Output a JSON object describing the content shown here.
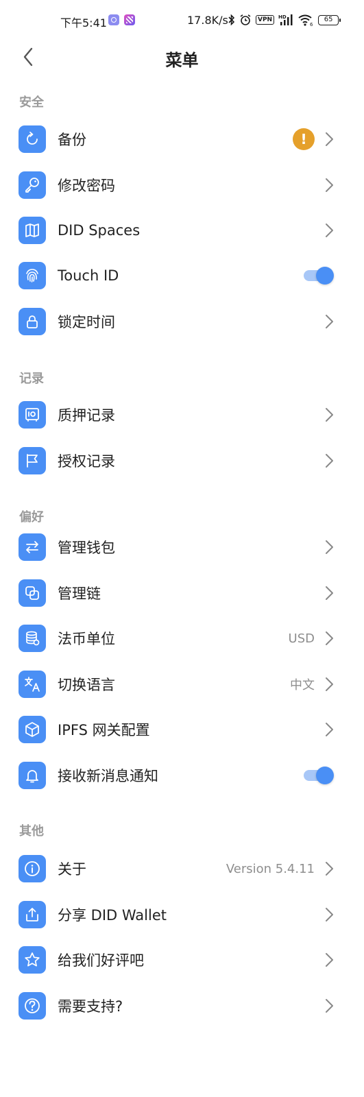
{
  "status_bar": {
    "time": "下午5:41",
    "speed": "17.8K/s",
    "vpn": "VPN",
    "hd": "HD",
    "wifi_sub": "6",
    "battery": "65"
  },
  "header": {
    "title": "菜单"
  },
  "sections": {
    "security": {
      "label": "安全",
      "backup": "备份",
      "backup_badge": "!",
      "change_password": "修改密码",
      "did_spaces": "DID Spaces",
      "touch_id": "Touch ID",
      "touch_id_enabled": true,
      "lock_time": "锁定时间"
    },
    "records": {
      "label": "记录",
      "stake_records": "质押记录",
      "auth_records": "授权记录"
    },
    "preferences": {
      "label": "偏好",
      "manage_wallet": "管理钱包",
      "manage_chain": "管理链",
      "fiat_unit": "法币单位",
      "fiat_unit_value": "USD",
      "switch_language": "切换语言",
      "switch_language_value": "中文",
      "ipfs_gateway": "IPFS 网关配置",
      "notifications": "接收新消息通知",
      "notifications_enabled": true
    },
    "other": {
      "label": "其他",
      "about": "关于",
      "about_value": "Version 5.4.11",
      "share": "分享 DID Wallet",
      "rate_us": "给我们好评吧",
      "need_support": "需要支持?"
    }
  },
  "colors": {
    "accent": "#4a8ff5",
    "warning": "#e5a02b",
    "section_label": "#9a9a9a"
  }
}
